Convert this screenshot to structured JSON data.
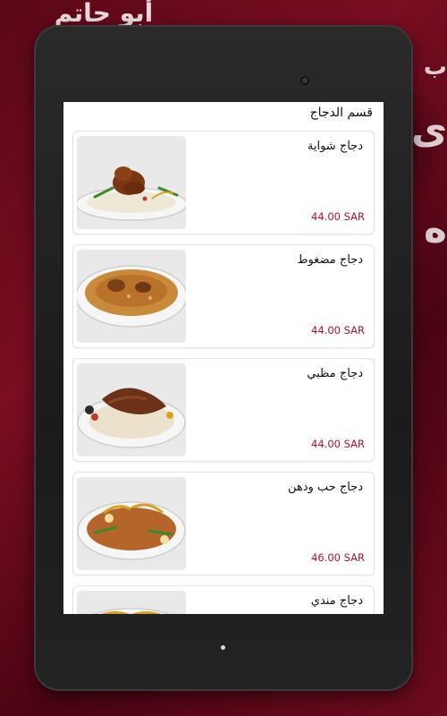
{
  "background": {
    "logo_text": "أبو حاتم",
    "accent_color": "#7a0e22"
  },
  "app": {
    "section_title": "قسم الدجاج",
    "price_color": "#b0102a"
  },
  "items": [
    {
      "name": "دجاج شواية",
      "price": "44.00 SAR",
      "image_icon": "grilled-chicken-rice-plate"
    },
    {
      "name": "دجاج مضغوط",
      "price": "44.00 SAR",
      "image_icon": "pressure-cooked-chicken-rice-plate"
    },
    {
      "name": "دجاج مظبي",
      "price": "44.00 SAR",
      "image_icon": "madhbi-chicken-rice-plate"
    },
    {
      "name": "دجاج حب ودهن",
      "price": "46.00 SAR",
      "image_icon": "chicken-grain-fat-rice-plate"
    },
    {
      "name": "دجاج مندي",
      "price": "",
      "image_icon": "mandi-chicken-rice-plate"
    }
  ]
}
